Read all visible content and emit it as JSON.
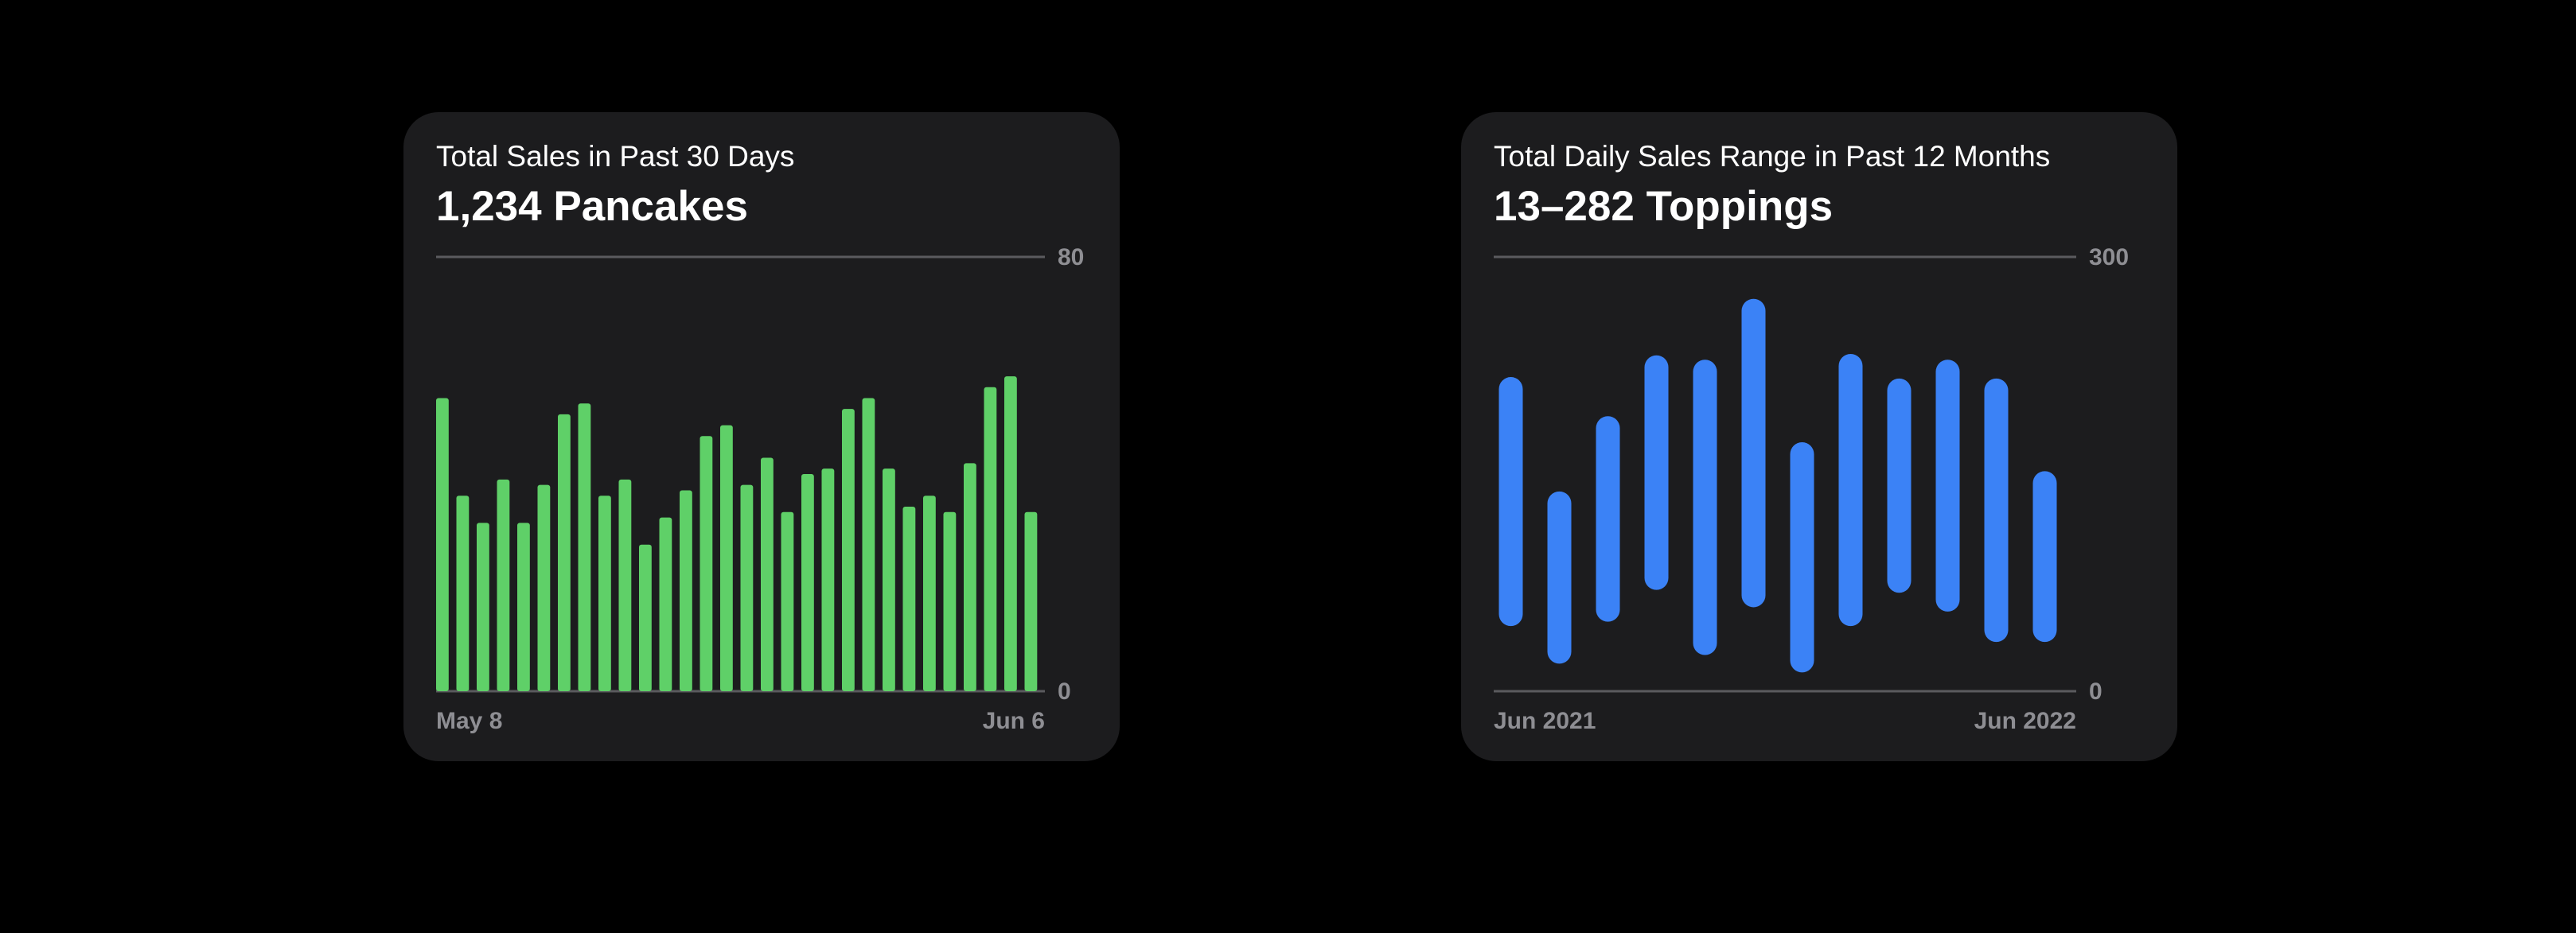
{
  "colors": {
    "background": "#000000",
    "card": "#1c1c1e",
    "axis": "#5a5a5e",
    "tick_text": "#8e8e93",
    "green": "#5fd068",
    "blue": "#3b82f6"
  },
  "cards": [
    {
      "subtitle": "Total Sales in Past 30 Days",
      "title": "1,234 Pancakes"
    },
    {
      "subtitle": "Total Daily Sales Range in Past 12 Months",
      "title": "13–282 Toppings"
    }
  ],
  "chart_data": [
    {
      "type": "bar",
      "title": "Total Sales in Past 30 Days",
      "ylim": [
        0,
        80
      ],
      "y_tick_labels": [
        "80",
        "0"
      ],
      "x_tick_labels": [
        "May 8",
        "Jun 6"
      ],
      "grid": false,
      "color": "#5fd068",
      "values": [
        54,
        36,
        31,
        39,
        31,
        38,
        51,
        53,
        36,
        39,
        27,
        32,
        37,
        47,
        49,
        38,
        43,
        33,
        40,
        41,
        52,
        54,
        41,
        34,
        36,
        33,
        42,
        56,
        58,
        33
      ]
    },
    {
      "type": "bar",
      "subtype": "range",
      "title": "Total Daily Sales Range in Past 12 Months",
      "ylim": [
        0,
        300
      ],
      "y_tick_labels": [
        "300",
        "0"
      ],
      "x_tick_labels": [
        "Jun 2021",
        "Jun 2022"
      ],
      "grid": false,
      "color": "#3b82f6",
      "ranges": [
        [
          45,
          217
        ],
        [
          19,
          138
        ],
        [
          48,
          190
        ],
        [
          70,
          232
        ],
        [
          25,
          229
        ],
        [
          58,
          271
        ],
        [
          13,
          172
        ],
        [
          45,
          233
        ],
        [
          68,
          216
        ],
        [
          55,
          229
        ],
        [
          34,
          216
        ],
        [
          34,
          152
        ]
      ]
    }
  ]
}
